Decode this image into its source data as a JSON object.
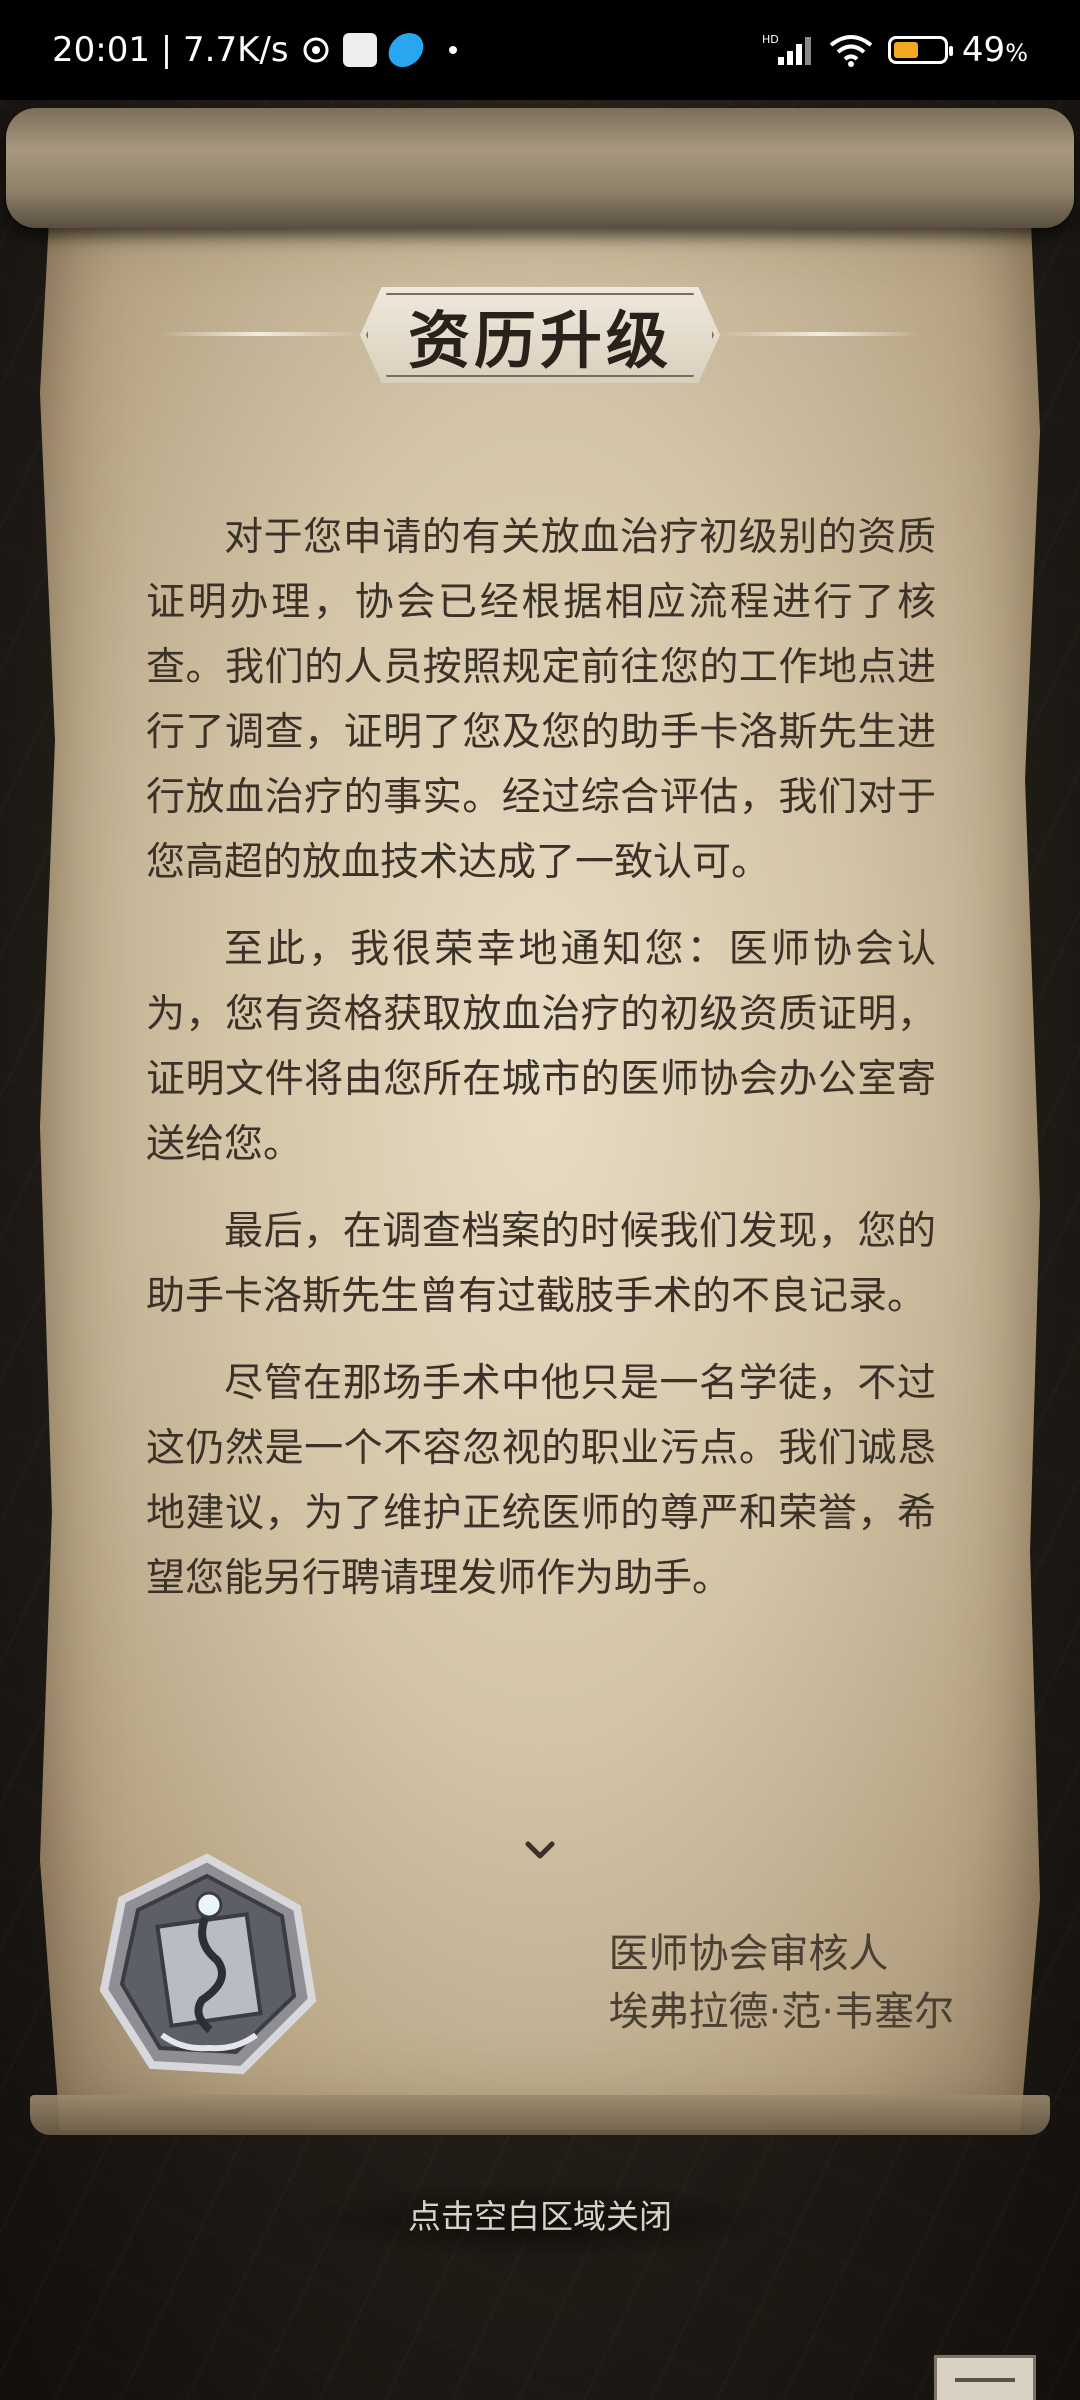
{
  "status_bar": {
    "time_speed": "20:01 | 7.7K/s",
    "hd_label": "HD",
    "battery_percent": "49",
    "battery_percent_sign": "%",
    "battery_level": 0.49,
    "battery_color": "#f2a920"
  },
  "letter": {
    "title": "资历升级",
    "paragraphs": [
      "对于您申请的有关放血治疗初级别的资质证明办理，协会已经根据相应流程进行了核查。我们的人员按照规定前往您的工作地点进行了调查，证明了您及您的助手卡洛斯先生进行放血治疗的事实。经过综合评估，我们对于您高超的放血技术达成了一致认可。",
      "至此，我很荣幸地通知您：医师协会认为，您有资格获取放血治疗的初级资质证明，证明文件将由您所在城市的医师协会办公室寄送给您。",
      "最后，在调查档案的时候我们发现，您的助手卡洛斯先生曾有过截肢手术的不良记录。",
      "尽管在那场手术中他只是一名学徒，不过这仍然是一个不容忽视的职业污点。我们诚恳地建议，为了维护正统医师的尊严和荣誉，希望您能另行聘请理发师作为助手。"
    ],
    "signature_role": "医师协会审核人",
    "signature_name": "埃弗拉德·范·韦塞尔",
    "badge_icon": "physician-guild-badge-icon",
    "more_icon": "chevron-down-icon"
  },
  "footer": {
    "close_hint": "点击空白区域关闭",
    "note_icon": "notebook-icon"
  }
}
